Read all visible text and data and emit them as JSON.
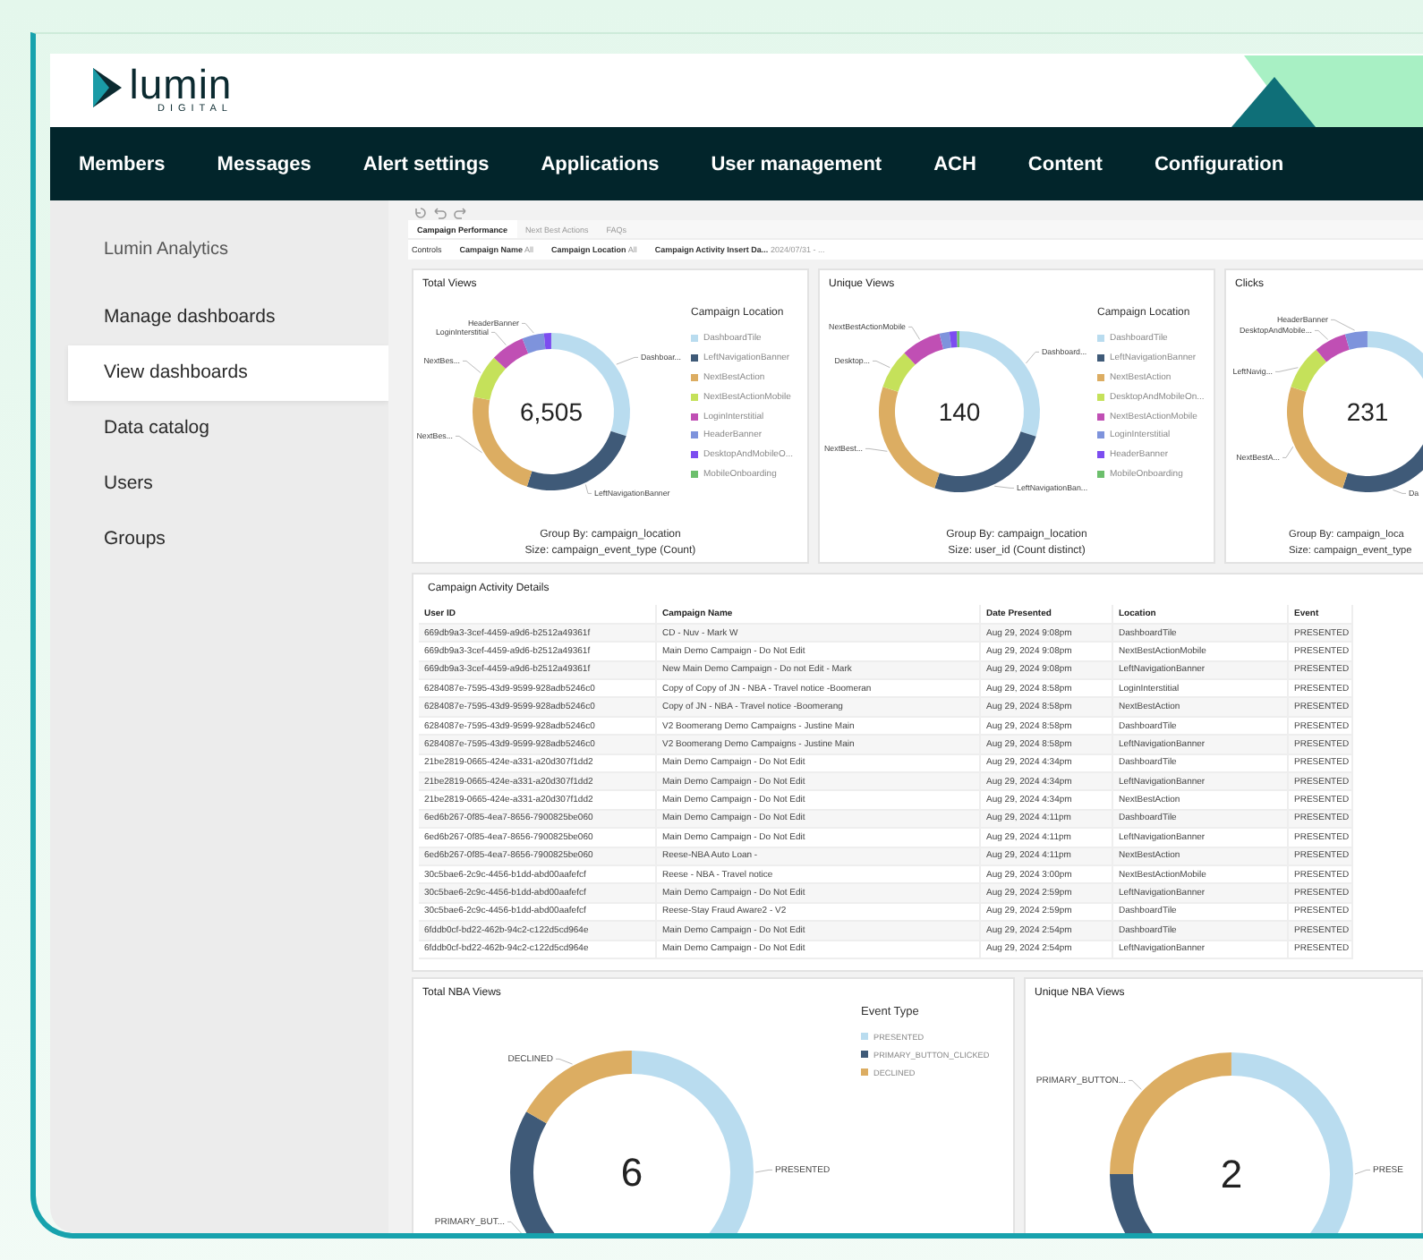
{
  "brand": {
    "name": "lumin",
    "tagline": "DIGITAL"
  },
  "nav": [
    "Members",
    "Messages",
    "Alert settings",
    "Applications",
    "User management",
    "ACH",
    "Content",
    "Configuration"
  ],
  "sidebar": {
    "heading": "Lumin Analytics",
    "items": [
      {
        "label": "Manage dashboards",
        "selected": false
      },
      {
        "label": "View dashboards",
        "selected": true
      },
      {
        "label": "Data catalog",
        "selected": false
      },
      {
        "label": "Users",
        "selected": false
      },
      {
        "label": "Groups",
        "selected": false
      }
    ]
  },
  "sheet_tabs": [
    {
      "label": "Campaign Performance",
      "selected": true
    },
    {
      "label": "Next Best Actions",
      "selected": false
    },
    {
      "label": "FAQs",
      "selected": false
    }
  ],
  "controls": {
    "label": "Controls",
    "filters": [
      {
        "name": "Campaign Name",
        "value": "All"
      },
      {
        "name": "Campaign Location",
        "value": "All"
      },
      {
        "name": "Campaign Activity Insert Da...",
        "value": "2024/07/31 - ..."
      }
    ]
  },
  "kpi_charts": [
    {
      "title": "Total Views",
      "total": "6,505",
      "slice_labels": [
        "HeaderBanner",
        "LoginInterstitial",
        "NextBes...",
        "Dashboar...",
        "NextBes...",
        "LeftNavigationBanner"
      ],
      "legend": {
        "title": "Campaign Location",
        "items": [
          {
            "label": "DashboardTile",
            "color": "#b9dcef"
          },
          {
            "label": "LeftNavigationBanner",
            "color": "#3f5a78"
          },
          {
            "label": "NextBestAction",
            "color": "#dcad62"
          },
          {
            "label": "NextBestActionMobile",
            "color": "#c5e15a"
          },
          {
            "label": "LoginInterstitial",
            "color": "#c04fb4"
          },
          {
            "label": "HeaderBanner",
            "color": "#7e93dc"
          },
          {
            "label": "DesktopAndMobileO...",
            "color": "#7c4df0"
          },
          {
            "label": "MobileOnboarding",
            "color": "#6cbf6c"
          }
        ]
      },
      "footer": [
        "Group By: campaign_location",
        "Size: campaign_event_type (Count)"
      ]
    },
    {
      "title": "Unique Views",
      "total": "140",
      "slice_labels": [
        "NextBestActionMobile",
        "Desktop...",
        "Dashboard...",
        "NextBest...",
        "LeftNavigationBan..."
      ],
      "legend": {
        "title": "Campaign Location",
        "items": [
          {
            "label": "DashboardTile",
            "color": "#b9dcef"
          },
          {
            "label": "LeftNavigationBanner",
            "color": "#3f5a78"
          },
          {
            "label": "NextBestAction",
            "color": "#dcad62"
          },
          {
            "label": "DesktopAndMobileOn...",
            "color": "#c5e15a"
          },
          {
            "label": "NextBestActionMobile",
            "color": "#c04fb4"
          },
          {
            "label": "LoginInterstitial",
            "color": "#7e93dc"
          },
          {
            "label": "HeaderBanner",
            "color": "#7c4df0"
          },
          {
            "label": "MobileOnboarding",
            "color": "#6cbf6c"
          }
        ]
      },
      "footer": [
        "Group By: campaign_location",
        "Size: user_id (Count distinct)"
      ]
    },
    {
      "title": "Clicks",
      "total": "231",
      "slice_labels": [
        "HeaderBanner",
        "DesktopAndMobile...",
        "LeftNavig...",
        "NextBestA...",
        "Da"
      ],
      "footer": [
        "Group By: campaign_loca",
        "Size: campaign_event_type"
      ]
    }
  ],
  "table": {
    "title": "Campaign Activity Details",
    "columns": [
      "User ID",
      "Campaign Name",
      "Date Presented",
      "Location",
      "Event"
    ],
    "rows": [
      [
        "669db9a3-3cef-4459-a9d6-b2512a49361f",
        "CD - Nuv - Mark W",
        "Aug 29, 2024 9:08pm",
        "DashboardTile",
        "PRESENTED"
      ],
      [
        "669db9a3-3cef-4459-a9d6-b2512a49361f",
        "Main Demo Campaign - Do Not Edit",
        "Aug 29, 2024 9:08pm",
        "NextBestActionMobile",
        "PRESENTED"
      ],
      [
        "669db9a3-3cef-4459-a9d6-b2512a49361f",
        "New Main Demo Campaign - Do not Edit - Mark",
        "Aug 29, 2024 9:08pm",
        "LeftNavigationBanner",
        "PRESENTED"
      ],
      [
        "6284087e-7595-43d9-9599-928adb5246c0",
        "Copy of Copy of JN - NBA - Travel notice -Boomeran",
        "Aug 29, 2024 8:58pm",
        "LoginInterstitial",
        "PRESENTED"
      ],
      [
        "6284087e-7595-43d9-9599-928adb5246c0",
        "Copy of JN - NBA - Travel notice -Boomerang",
        "Aug 29, 2024 8:58pm",
        "NextBestAction",
        "PRESENTED"
      ],
      [
        "6284087e-7595-43d9-9599-928adb5246c0",
        "V2 Boomerang Demo Campaigns - Justine Main",
        "Aug 29, 2024 8:58pm",
        "DashboardTile",
        "PRESENTED"
      ],
      [
        "6284087e-7595-43d9-9599-928adb5246c0",
        "V2 Boomerang Demo Campaigns - Justine Main",
        "Aug 29, 2024 8:58pm",
        "LeftNavigationBanner",
        "PRESENTED"
      ],
      [
        "21be2819-0665-424e-a331-a20d307f1dd2",
        "Main Demo Campaign - Do Not Edit",
        "Aug 29, 2024 4:34pm",
        "DashboardTile",
        "PRESENTED"
      ],
      [
        "21be2819-0665-424e-a331-a20d307f1dd2",
        "Main Demo Campaign - Do Not Edit",
        "Aug 29, 2024 4:34pm",
        "LeftNavigationBanner",
        "PRESENTED"
      ],
      [
        "21be2819-0665-424e-a331-a20d307f1dd2",
        "Main Demo Campaign - Do Not Edit",
        "Aug 29, 2024 4:34pm",
        "NextBestAction",
        "PRESENTED"
      ],
      [
        "6ed6b267-0f85-4ea7-8656-7900825be060",
        "Main Demo Campaign - Do Not Edit",
        "Aug 29, 2024 4:11pm",
        "DashboardTile",
        "PRESENTED"
      ],
      [
        "6ed6b267-0f85-4ea7-8656-7900825be060",
        "Main Demo Campaign - Do Not Edit",
        "Aug 29, 2024 4:11pm",
        "LeftNavigationBanner",
        "PRESENTED"
      ],
      [
        "6ed6b267-0f85-4ea7-8656-7900825be060",
        "Reese-NBA Auto Loan -",
        "Aug 29, 2024 4:11pm",
        "NextBestAction",
        "PRESENTED"
      ],
      [
        "30c5bae6-2c9c-4456-b1dd-abd00aafefcf",
        "Reese - NBA - Travel notice",
        "Aug 29, 2024 3:00pm",
        "NextBestActionMobile",
        "PRESENTED"
      ],
      [
        "30c5bae6-2c9c-4456-b1dd-abd00aafefcf",
        "Main Demo Campaign - Do Not Edit",
        "Aug 29, 2024 2:59pm",
        "LeftNavigationBanner",
        "PRESENTED"
      ],
      [
        "30c5bae6-2c9c-4456-b1dd-abd00aafefcf",
        "Reese-Stay Fraud Aware2 - V2",
        "Aug 29, 2024 2:59pm",
        "DashboardTile",
        "PRESENTED"
      ],
      [
        "6fddb0cf-bd22-462b-94c2-c122d5cd964e",
        "Main Demo Campaign - Do Not Edit",
        "Aug 29, 2024 2:54pm",
        "DashboardTile",
        "PRESENTED"
      ],
      [
        "6fddb0cf-bd22-462b-94c2-c122d5cd964e",
        "Main Demo Campaign - Do Not Edit",
        "Aug 29, 2024 2:54pm",
        "LeftNavigationBanner",
        "PRESENTED"
      ]
    ]
  },
  "event_charts": [
    {
      "title": "Total NBA Views",
      "total": "6",
      "slice_labels": [
        "DECLINED",
        "PRESENTED",
        "PRIMARY_BUT..."
      ],
      "legend": {
        "title": "Event Type",
        "items": [
          {
            "label": "PRESENTED",
            "color": "#b9dcef"
          },
          {
            "label": "PRIMARY_BUTTON_CLICKED",
            "color": "#3f5a78"
          },
          {
            "label": "DECLINED",
            "color": "#dcad62"
          }
        ]
      }
    },
    {
      "title": "Unique NBA Views",
      "total": "2",
      "slice_labels": [
        "PRIMARY_BUTTON...",
        "PRESE"
      ]
    }
  ]
}
